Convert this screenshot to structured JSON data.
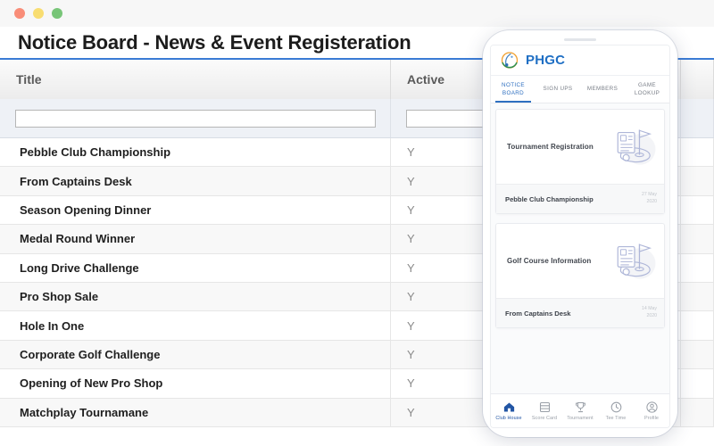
{
  "window": {
    "traffic_lights": [
      "close",
      "minimize",
      "maximize"
    ],
    "colors": {
      "close": "#f98d78",
      "minimize": "#f8dd71",
      "maximize": "#78c578"
    }
  },
  "page": {
    "title": "Notice Board - News & Event Registeration"
  },
  "grid": {
    "columns": [
      {
        "key": "title",
        "label": "Title"
      },
      {
        "key": "active",
        "label": "Active"
      },
      {
        "key": "extra",
        "label": ""
      }
    ],
    "filters": {
      "title_value": "",
      "title_placeholder": "",
      "active_value": "",
      "active_placeholder": ""
    },
    "rows": [
      {
        "title": "Pebble Club Championship",
        "active": "Y"
      },
      {
        "title": "From Captains Desk",
        "active": "Y"
      },
      {
        "title": "Season Opening Dinner",
        "active": "Y"
      },
      {
        "title": "Medal Round Winner",
        "active": "Y"
      },
      {
        "title": "Long Drive Challenge",
        "active": "Y"
      },
      {
        "title": "Pro Shop Sale",
        "active": "Y"
      },
      {
        "title": "Hole In One",
        "active": "Y"
      },
      {
        "title": "Corporate Golf Challenge",
        "active": "Y"
      },
      {
        "title": "Opening of New Pro Shop",
        "active": "Y"
      },
      {
        "title": "Matchplay Tournamane",
        "active": "Y"
      }
    ]
  },
  "phone": {
    "brand": "PHGC",
    "logo_icon": "golf-club-emblem-icon",
    "accent_color": "#2e6fc0",
    "tabs": [
      {
        "line1": "NOTICE",
        "line2": "BOARD",
        "active": true
      },
      {
        "line1": "SIGN UPS",
        "line2": "",
        "active": false
      },
      {
        "line1": "MEMBERS",
        "line2": "",
        "active": false
      },
      {
        "line1": "GAME",
        "line2": "LOOKUP",
        "active": false
      }
    ],
    "cards": [
      {
        "label": "Tournament Registration",
        "illustration": "golf-flag-document-icon",
        "footer_title": "Pebble Club Championship",
        "footer_date_day": "27 May",
        "footer_date_year": "2020"
      },
      {
        "label": "Golf Course Information",
        "illustration": "golf-flag-document-icon",
        "footer_title": "From Captains Desk",
        "footer_date_day": "14 May",
        "footer_date_year": "2020"
      }
    ],
    "nav": [
      {
        "label": "Club House",
        "icon": "home-icon",
        "active": true
      },
      {
        "label": "Score Card",
        "icon": "scorecard-icon",
        "active": false
      },
      {
        "label": "Tournament",
        "icon": "trophy-icon",
        "active": false
      },
      {
        "label": "Tee Time",
        "icon": "clock-icon",
        "active": false
      },
      {
        "label": "Profile",
        "icon": "person-icon",
        "active": false
      }
    ]
  }
}
